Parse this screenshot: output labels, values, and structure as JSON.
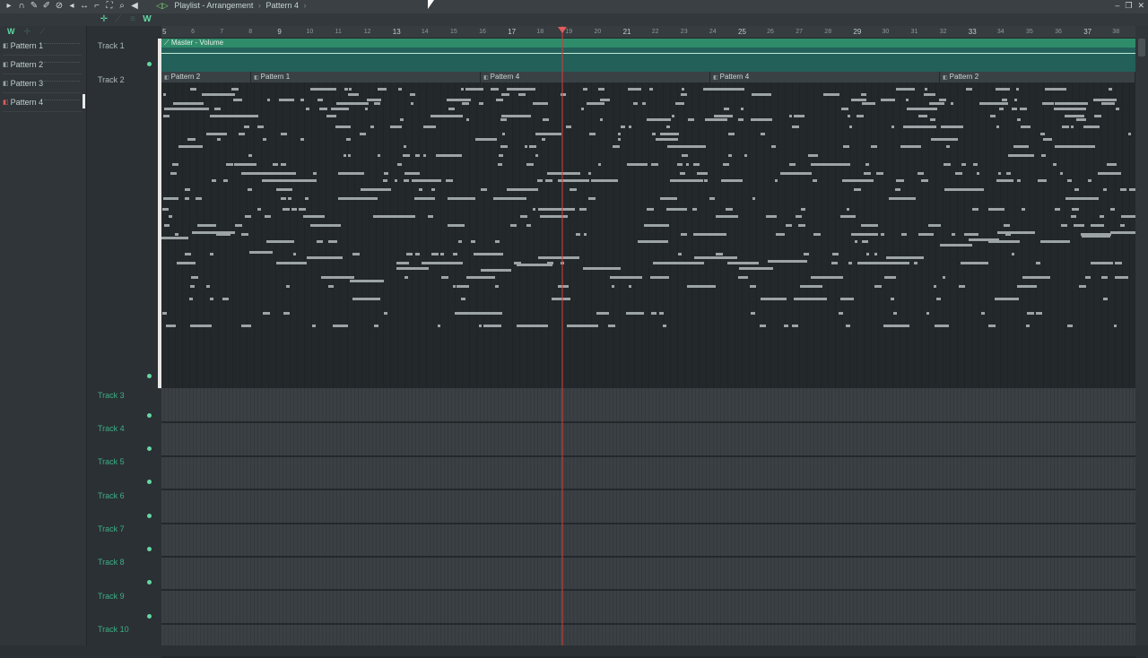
{
  "window": {
    "breadcrumb": [
      "Playlist - Arrangement",
      "Pattern 4"
    ],
    "controls": [
      "minimize-icon",
      "restore-icon",
      "close-icon"
    ]
  },
  "toolbar": {
    "tools": [
      "play-icon",
      "magnet-icon",
      "pencil-icon",
      "paint-icon",
      "delete-icon",
      "mute-icon",
      "slip-icon",
      "slice-icon",
      "select-icon",
      "zoom-icon",
      "speaker-icon"
    ]
  },
  "pattern_panel": {
    "patterns": [
      {
        "label": "Pattern 1",
        "active": false
      },
      {
        "label": "Pattern 2",
        "active": false
      },
      {
        "label": "Pattern 3",
        "active": false
      },
      {
        "label": "Pattern 4",
        "active": true
      }
    ]
  },
  "ruler": {
    "major_labels": [
      "5",
      "9",
      "13",
      "17",
      "21",
      "25",
      "29",
      "33",
      "37"
    ],
    "minor_labels": [
      "6",
      "7",
      "8",
      "10",
      "11",
      "12",
      "14",
      "15",
      "16",
      "18",
      "19",
      "20",
      "22",
      "23",
      "24",
      "26",
      "27",
      "28",
      "30",
      "31",
      "32",
      "34",
      "35",
      "36",
      "38",
      "39"
    ]
  },
  "tracks": [
    {
      "label": "Track 1"
    },
    {
      "label": "Track 2"
    },
    {
      "label": "Track 3"
    },
    {
      "label": "Track 4"
    },
    {
      "label": "Track 5"
    },
    {
      "label": "Track 6"
    },
    {
      "label": "Track 7"
    },
    {
      "label": "Track 8"
    },
    {
      "label": "Track 9"
    },
    {
      "label": "Track 10"
    }
  ],
  "automation_clip": {
    "label": "Master - Volume"
  },
  "track2_clips": [
    "Pattern 2",
    "Pattern 1",
    "Pattern 4",
    "Pattern 4",
    "Pattern 2"
  ],
  "colors": {
    "accent": "#63d7a2",
    "playhead": "#e05c5c",
    "automation": "#2f8c6a"
  }
}
